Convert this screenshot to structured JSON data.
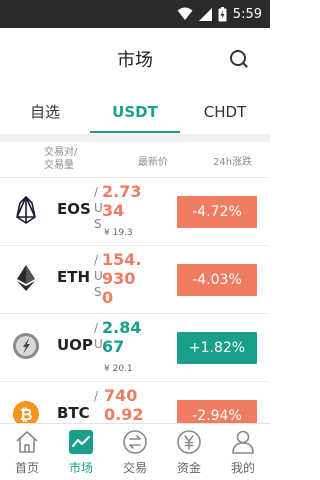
{
  "status_bar": {
    "time": "5:59"
  },
  "header": {
    "title": "市场"
  },
  "tabs": [
    {
      "label": "自选",
      "active": false
    },
    {
      "label": "USDT",
      "active": true
    },
    {
      "label": "CHDT",
      "active": false
    }
  ],
  "columns": {
    "pair_line1": "交易对/",
    "pair_line2": "交易量",
    "price": "最新价",
    "change": "24h涨跌"
  },
  "rows": [
    {
      "symbol": "EOS",
      "suffix": "/ U S",
      "price": "2.7334",
      "cny": "¥ 19.3",
      "change": "-4.72%",
      "direction": "down",
      "icon": "eos-icon"
    },
    {
      "symbol": "ETH",
      "suffix": "/ U S",
      "price": "154.9300",
      "cny": "",
      "change": "-4.03%",
      "direction": "down",
      "icon": "eth-icon"
    },
    {
      "symbol": "UOP",
      "suffix": "/ U",
      "price": "2.8467",
      "cny": "¥ 20.1",
      "change": "+1.82%",
      "direction": "up",
      "icon": "uop-icon"
    },
    {
      "symbol": "BTC",
      "suffix": "/",
      "price": "7400.92",
      "cny": "",
      "change": "-2.94%",
      "direction": "down",
      "icon": "btc-icon"
    }
  ],
  "bottom_nav": [
    {
      "label": "首页",
      "icon": "home-icon",
      "active": false
    },
    {
      "label": "市场",
      "icon": "market-chart-icon",
      "active": true
    },
    {
      "label": "交易",
      "icon": "exchange-icon",
      "active": false
    },
    {
      "label": "资金",
      "icon": "yuan-funds-icon",
      "active": false
    },
    {
      "label": "我的",
      "icon": "profile-icon",
      "active": false
    }
  ],
  "colors": {
    "accent": "#1aa08a",
    "down": "#f07c62",
    "up": "#1aa08a"
  }
}
